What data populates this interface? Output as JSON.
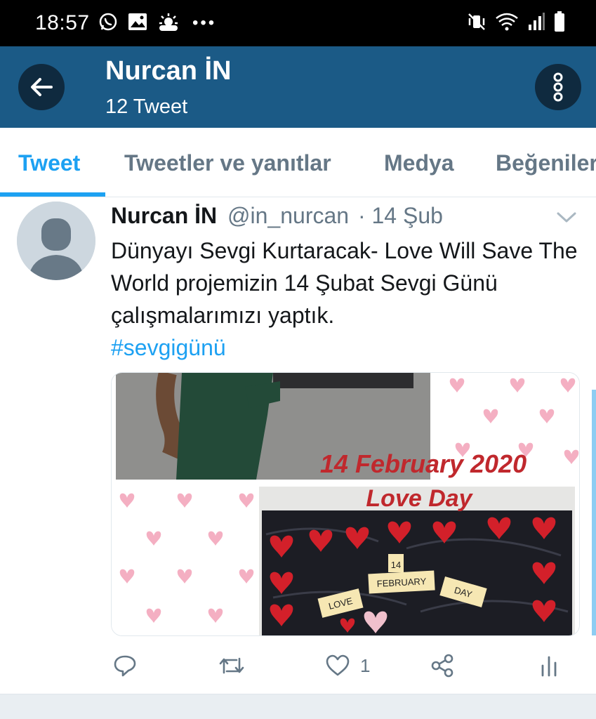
{
  "status_bar": {
    "time": "18:57",
    "left_icons": [
      "whatsapp-icon",
      "gallery-icon",
      "weather-icon",
      "more-notifications-icon"
    ],
    "right_icons": [
      "vibrate-mute-icon",
      "wifi-icon",
      "signal-icon",
      "battery-icon"
    ]
  },
  "header": {
    "name": "Nurcan İN",
    "tweet_count": "12 Tweet"
  },
  "tabs": [
    {
      "label": "Tweet",
      "active": true
    },
    {
      "label": "Tweetler ve yanıtlar",
      "active": false
    },
    {
      "label": "Medya",
      "active": false
    },
    {
      "label": "Beğeniler",
      "active": false
    }
  ],
  "tweet": {
    "author_name": "Nurcan İN",
    "handle": "@in_nurcan",
    "date": "· 14 Şub",
    "text": "Dünyayı Sevgi Kurtaracak- Love Will Save The World projemizin 14 Şubat Sevgi Günü çalışmalarımızı yaptık.",
    "hashtag": "#sevgigünü",
    "media": {
      "banner_line1": "14 February 2020",
      "banner_line2": "Love Day",
      "sign_14": "14",
      "sign_february": "FEBRUARY",
      "sign_love": "LOVE",
      "sign_day": "DAY"
    },
    "actions": {
      "reply_icon": "reply-icon",
      "retweet_icon": "retweet-icon",
      "like_icon": "heart-icon",
      "like_count": "1",
      "share_icon": "share-icon",
      "analytics_icon": "analytics-icon"
    }
  },
  "colors": {
    "header_bg": "#1b5a86",
    "accent": "#1da1f2",
    "muted": "#657786",
    "text": "#14171a",
    "banner_red": "#c0282d"
  }
}
